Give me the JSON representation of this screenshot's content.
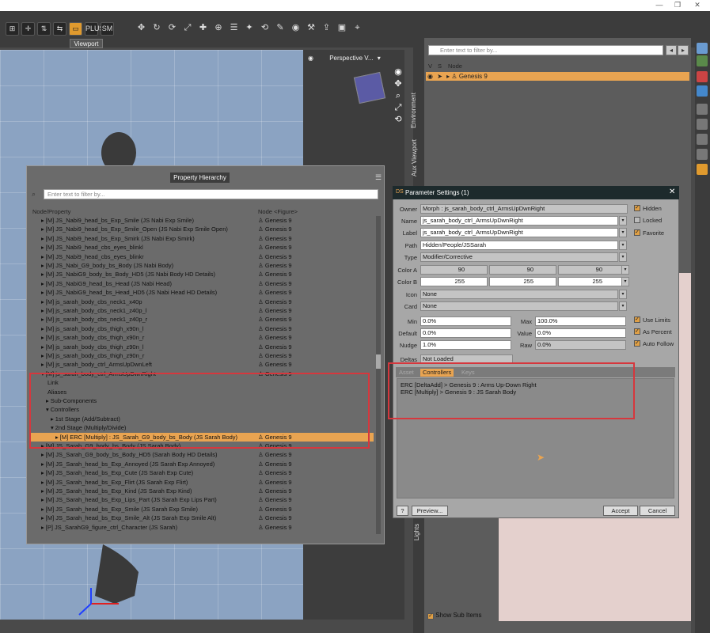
{
  "window": {
    "min": "—",
    "max": "❐",
    "close": "✕"
  },
  "toolbar": {
    "buttons": [
      "⊞",
      "✛",
      "⇅",
      "⇆",
      "▭",
      "PLUS",
      "SM"
    ],
    "icons": [
      "✥",
      "↻",
      "⟳",
      "⤢",
      "✚",
      "⊕",
      "☰",
      "✦",
      "⟲",
      "✎",
      "◉",
      "⚒",
      "⇪",
      "▣",
      "⌖"
    ]
  },
  "viewport": {
    "tab": "Viewport",
    "camera": "Perspective V...",
    "nav": [
      "◉",
      "✥",
      "⌕",
      "⤢",
      "⟲"
    ]
  },
  "dock_tabs": {
    "environment": "Environment",
    "aux": "Aux Viewport",
    "lights": "Lights"
  },
  "scene": {
    "filter_placeholder": "Enter text to filter by...",
    "col_v": "V",
    "col_s": "S",
    "col_node": "Node",
    "row_label": "Genesis 9",
    "show_sub": "Show Sub Items"
  },
  "property_hierarchy": {
    "title": "Property Hierarchy",
    "filter_placeholder": "Enter text to filter by...",
    "col_node_property": "Node/Property",
    "col_node": "Node <Figure>",
    "rows": [
      {
        "arrow": "▸",
        "label": "[M] JS_Nabi9_head_bs_Exp_Smile (JS Nabi Exp Smile)",
        "node": "Genesis 9",
        "indent": 0
      },
      {
        "arrow": "▸",
        "label": "[M] JS_Nabi9_head_bs_Exp_Smile_Open (JS Nabi Exp Smile Open)",
        "node": "Genesis 9",
        "indent": 0
      },
      {
        "arrow": "▸",
        "label": "[M] JS_Nabi9_head_bs_Exp_Smirk (JS Nabi Exp Smirk)",
        "node": "Genesis 9",
        "indent": 0
      },
      {
        "arrow": "▸",
        "label": "[M] JS_Nabi9_head_cbs_eyes_blinkl",
        "node": "Genesis 9",
        "indent": 0
      },
      {
        "arrow": "▸",
        "label": "[M] JS_Nabi9_head_cbs_eyes_blinkr",
        "node": "Genesis 9",
        "indent": 0
      },
      {
        "arrow": "▸",
        "label": "[M] JS_Nabi_G9_body_bs_Body (JS Nabi Body)",
        "node": "Genesis 9",
        "indent": 0
      },
      {
        "arrow": "▸",
        "label": "[M] JS_NabiG9_body_bs_Body_HD5 (JS Nabi Body HD Details)",
        "node": "Genesis 9",
        "indent": 0
      },
      {
        "arrow": "▸",
        "label": "[M] JS_NabiG9_head_bs_Head (JS Nabi Head)",
        "node": "Genesis 9",
        "indent": 0
      },
      {
        "arrow": "▸",
        "label": "[M] JS_NabiG9_head_bs_Head_HD5 (JS Nabi Head HD Details)",
        "node": "Genesis 9",
        "indent": 0
      },
      {
        "arrow": "▸",
        "label": "[M] js_sarah_body_cbs_neck1_x40p",
        "node": "Genesis 9",
        "indent": 0
      },
      {
        "arrow": "▸",
        "label": "[M] js_sarah_body_cbs_neck1_z40p_l",
        "node": "Genesis 9",
        "indent": 0
      },
      {
        "arrow": "▸",
        "label": "[M] js_sarah_body_cbs_neck1_z40p_r",
        "node": "Genesis 9",
        "indent": 0
      },
      {
        "arrow": "▸",
        "label": "[M] js_sarah_body_cbs_thigh_x90n_l",
        "node": "Genesis 9",
        "indent": 0
      },
      {
        "arrow": "▸",
        "label": "[M] js_sarah_body_cbs_thigh_x90n_r",
        "node": "Genesis 9",
        "indent": 0
      },
      {
        "arrow": "▸",
        "label": "[M] js_sarah_body_cbs_thigh_z90n_l",
        "node": "Genesis 9",
        "indent": 0
      },
      {
        "arrow": "▸",
        "label": "[M] js_sarah_body_cbs_thigh_z90n_r",
        "node": "Genesis 9",
        "indent": 0
      },
      {
        "arrow": "▸",
        "label": "[M] js_sarah_body_ctrl_ArmsUpDwnLeft",
        "node": "Genesis 9",
        "indent": 0
      },
      {
        "arrow": "▾",
        "label": "[M] js_sarah_body_ctrl_ArmsUpDwnRight",
        "node": "Genesis 9",
        "indent": 0
      },
      {
        "arrow": "",
        "label": "Link",
        "node": "",
        "indent": 1
      },
      {
        "arrow": "",
        "label": "Aliases",
        "node": "",
        "indent": 1
      },
      {
        "arrow": "▸",
        "label": "Sub-Components",
        "node": "",
        "indent": 1
      },
      {
        "arrow": "▾",
        "label": "Controllers",
        "node": "",
        "indent": 1
      },
      {
        "arrow": "▸",
        "label": "1st Stage (Add/Subtract)",
        "node": "",
        "indent": 2
      },
      {
        "arrow": "▾",
        "label": "2nd Stage (Multiply/Divide)",
        "node": "",
        "indent": 2
      },
      {
        "arrow": "▸",
        "label": "[M] ERC [Multiply] : JS_Sarah_G9_body_bs_Body (JS Sarah Body)",
        "node": "Genesis 9",
        "indent": 3,
        "selected": true
      },
      {
        "arrow": "▸",
        "label": "[M] JS_Sarah_G9_body_bs_Body (JS Sarah Body)",
        "node": "Genesis 9",
        "indent": 0
      },
      {
        "arrow": "▸",
        "label": "[M] JS_Sarah_G9_body_bs_Body_HD5 (Sarah Body HD Details)",
        "node": "Genesis 9",
        "indent": 0
      },
      {
        "arrow": "▸",
        "label": "[M] JS_Sarah_head_bs_Exp_Annoyed (JS Sarah Exp Annoyed)",
        "node": "Genesis 9",
        "indent": 0
      },
      {
        "arrow": "▸",
        "label": "[M] JS_Sarah_head_bs_Exp_Cute (JS Sarah Exp Cute)",
        "node": "Genesis 9",
        "indent": 0
      },
      {
        "arrow": "▸",
        "label": "[M] JS_Sarah_head_bs_Exp_Flirt (JS Sarah Exp Flirt)",
        "node": "Genesis 9",
        "indent": 0
      },
      {
        "arrow": "▸",
        "label": "[M] JS_Sarah_head_bs_Exp_Kind (JS Sarah Exp Kind)",
        "node": "Genesis 9",
        "indent": 0
      },
      {
        "arrow": "▸",
        "label": "[M] JS_Sarah_head_bs_Exp_Lips_Part (JS Sarah Exp Lips Part)",
        "node": "Genesis 9",
        "indent": 0
      },
      {
        "arrow": "▸",
        "label": "[M] JS_Sarah_head_bs_Exp_Smile (JS Sarah Exp Smile)",
        "node": "Genesis 9",
        "indent": 0
      },
      {
        "arrow": "▸",
        "label": "[M] JS_Sarah_head_bs_Exp_Smile_Alt (JS Sarah Exp Smile Alt)",
        "node": "Genesis 9",
        "indent": 0
      },
      {
        "arrow": "▸",
        "label": "[P] JS_SarahG9_figure_ctrl_Character (JS Sarah)",
        "node": "Genesis 9",
        "indent": 0
      }
    ]
  },
  "param": {
    "title": "Parameter Settings (1)",
    "owner_label": "Owner",
    "owner": "Morph : js_sarah_body_ctrl_ArmsUpDwnRight",
    "name_label": "Name",
    "name": "js_sarah_body_ctrl_ArmsUpDwnRight",
    "label_label": "Label",
    "label": "js_sarah_body_ctrl_ArmsUpDwnRight",
    "path_label": "Path",
    "path": "Hidden/People/JSSarah",
    "type_label": "Type",
    "type": "Modifier/Corrective",
    "colora_label": "Color A",
    "colora": [
      "90",
      "90",
      "90"
    ],
    "colorb_label": "Color B",
    "colorb": [
      "255",
      "255",
      "255"
    ],
    "icon_label": "Icon",
    "icon": "None",
    "card_label": "Card",
    "card": "None",
    "hidden": "Hidden",
    "locked": "Locked",
    "favorite": "Favorite",
    "min_label": "Min",
    "min": "0.0%",
    "max_label": "Max",
    "max": "100.0%",
    "default_label": "Default",
    "default": "0.0%",
    "value_label": "Value",
    "value": "0.0%",
    "nudge_label": "Nudge",
    "nudge": "1.0%",
    "raw_label": "Raw",
    "raw": "0.0%",
    "use_limits": "Use Limits",
    "as_percent": "As Percent",
    "auto_follow": "Auto Follow",
    "deltas_label": "Deltas",
    "deltas": "Not Loaded",
    "tabs": [
      "Asset",
      "Controllers",
      "Keys"
    ],
    "controllers": [
      "ERC [DeltaAdd] > Genesis 9 : Arms Up-Down Right",
      "ERC [Multiply] > Genesis 9 : JS Sarah Body"
    ],
    "help": "?",
    "preview": "Preview...",
    "accept": "Accept",
    "cancel": "Cancel"
  },
  "colors": {
    "accent": "#e9a451",
    "highlight": "#d6373d",
    "viewport": "#8ba3c2"
  }
}
